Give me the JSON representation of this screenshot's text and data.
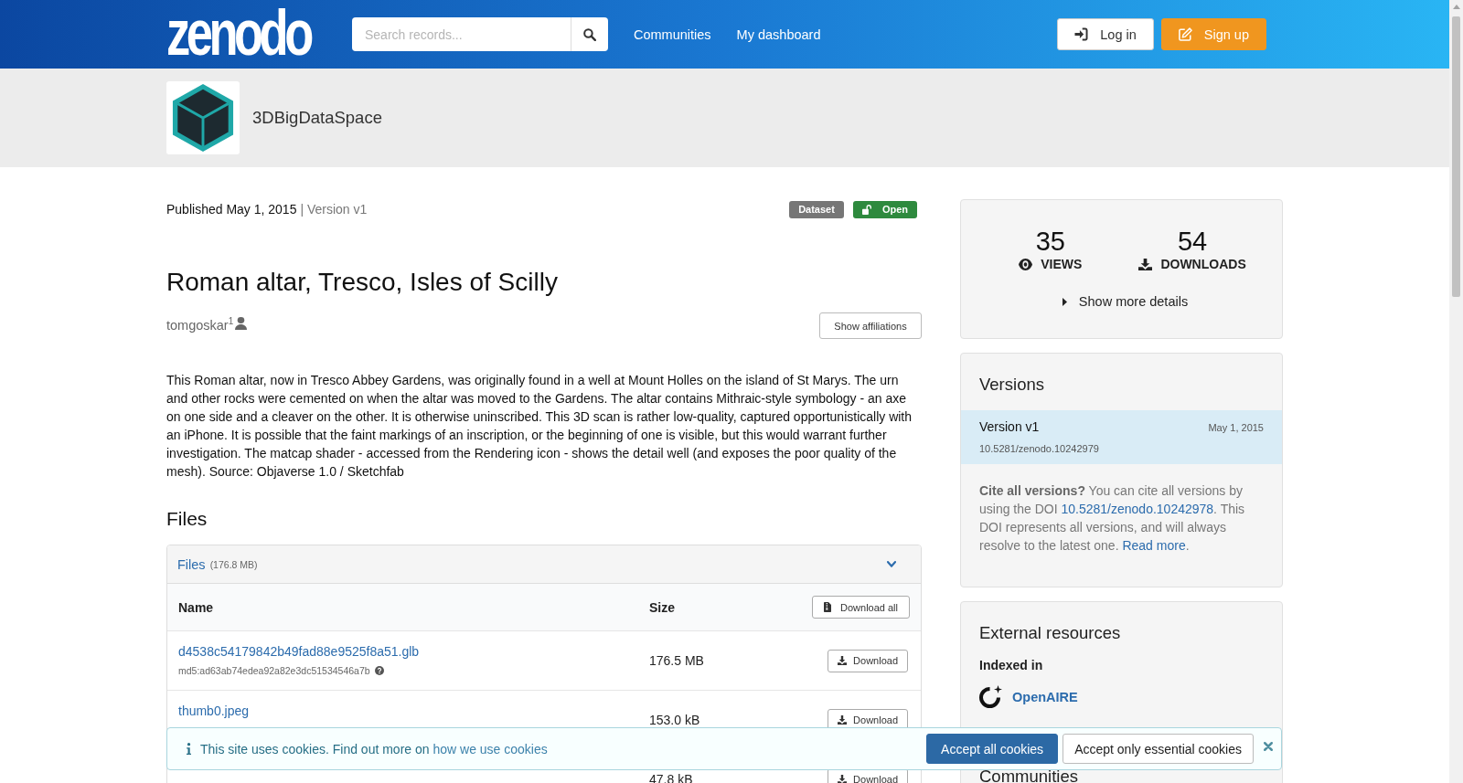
{
  "header": {
    "logo": "zenodo",
    "search": {
      "placeholder": "Search records..."
    },
    "nav": [
      {
        "label": "Communities"
      },
      {
        "label": "My dashboard"
      }
    ],
    "buttons": [
      {
        "label": "Log in",
        "kind": "login"
      },
      {
        "label": "Sign up",
        "kind": "signup"
      }
    ]
  },
  "community": {
    "name": "3DBigDataSpace"
  },
  "record": {
    "published": "Published May 1, 2015",
    "version": "| Version v1",
    "badges": [
      {
        "label": "Dataset",
        "kind": "resource_type"
      },
      {
        "label": "Open",
        "kind": "access"
      }
    ],
    "title": "Roman altar, Tresco, Isles of Scilly",
    "creators": [
      {
        "name": "tomgoskar$^{1}$"
      }
    ],
    "affiliations_button": "Show affiliations",
    "description": "This Roman altar, now in Tresco Abbey Gardens, was originally found in a well at Mount Holles on the island of St Marys. The urn and other rocks were cemented on when the altar was moved to the Gardens. The altar contains Mithraic-style symbology - an axe on one side and a cleaver on the other. It is otherwise uninscribed. This 3D scan is rather low-quality, captured opportunistically with an iPhone. It is possible that the faint markings of an inscription, or the beginning of one is visible, but this would warrant further investigation. The matcap shader - accessed from the Rendering icon - shows the detail well (and exposes the poor quality of the mesh). Source: Objaverse 1.0 / Sketchfab"
  },
  "files": {
    "heading": "Files",
    "panel": {
      "title": "Files",
      "size": "(176.8 MB)",
      "expanded": true
    },
    "columns": [
      "Name",
      "Size"
    ],
    "download_all": "Download all",
    "rows": [
      {
        "name": "d4538c54179842b49fad88e9525f8a51.glb",
        "md5": "md5:ad63ab74edea92a82e3dc51534546a7b",
        "size": "176.5 MB",
        "action": "Download"
      },
      {
        "name": "thumb0.jpeg",
        "size": "153.0 kB",
        "action": "Download"
      },
      {
        "size": "47.8 kB",
        "action": "Download"
      }
    ]
  },
  "sidebar": {
    "stats": [
      {
        "value": "35",
        "label": "VIEWS",
        "kind": "views"
      },
      {
        "value": "54",
        "label": "DOWNLOADS",
        "kind": "downloads"
      }
    ],
    "details_toggle": {
      "label": "Show more details",
      "expanded": false
    },
    "versions": {
      "heading": "Versions",
      "items": [
        {
          "label": "Version v1",
          "date": "May 1, 2015",
          "doi": "10.5281/zenodo.10242979",
          "selected": true
        }
      ],
      "cite": {
        "text": "**Cite all versions?** You can cite all versions by using the DOI ",
        "doi": "10.5281/zenodo.10242978",
        "after": ". This DOI represents all versions, and will always resolve to the latest one. ",
        "link": "Read more",
        "end": "."
      }
    },
    "external": {
      "heading": "External resources",
      "subheading": "Indexed in",
      "links": [
        {
          "label": "OpenAIRE"
        }
      ]
    },
    "communities": {
      "heading": "Communities"
    }
  },
  "cookie_banner": {
    "text": "This site uses cookies. Find out more on ",
    "link": "how we use cookies",
    "buttons": [
      {
        "label": "Accept all cookies",
        "kind": "primary"
      },
      {
        "label": "Accept only essential cookies",
        "kind": "secondary"
      }
    ]
  }
}
